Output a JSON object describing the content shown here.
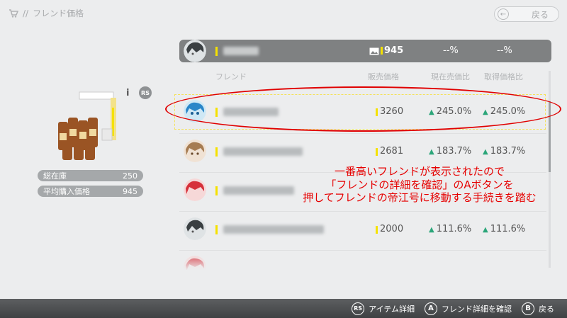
{
  "breadcrumb": {
    "separator": "//",
    "title": "フレンド価格",
    "icon": "cart-icon"
  },
  "back_button": {
    "label": "戻る"
  },
  "item": {
    "info_label": "i",
    "rs_label": "RS",
    "stats": [
      {
        "label": "総在庫",
        "value": "250"
      },
      {
        "label": "平均購入価格",
        "value": "945"
      }
    ]
  },
  "my_row": {
    "price": "945",
    "current_ratio": "--%",
    "acquired_ratio": "--%"
  },
  "columns": {
    "friend": "フレンド",
    "price": "販売価格",
    "current_ratio": "現在売価比",
    "acquired_ratio": "取得価格比"
  },
  "friends": [
    {
      "price": "3260",
      "current_ratio": "245.0%",
      "acquired_ratio": "245.0%"
    },
    {
      "price": "2681",
      "current_ratio": "183.7%",
      "acquired_ratio": "183.7%"
    },
    {
      "price": "",
      "current_ratio": "",
      "acquired_ratio": ""
    },
    {
      "price": "2000",
      "current_ratio": "111.6%",
      "acquired_ratio": "111.6%"
    },
    {
      "price": "",
      "current_ratio": "",
      "acquired_ratio": ""
    }
  ],
  "annotation": {
    "line1": "一番高いフレンドが表示されたので",
    "line2": "「フレンドの詳細を確認」のAボタンを",
    "line3": "押してフレンドの帝江号に移動する手続きを踏む"
  },
  "footer": {
    "hints": [
      {
        "button": "RS",
        "label": "アイテム詳細"
      },
      {
        "button": "A",
        "label": "フレンド詳細を確認"
      },
      {
        "button": "B",
        "label": "戻る"
      }
    ]
  },
  "colors": {
    "accent_yellow": "#f5e100",
    "up_green": "#2ca67a",
    "annotation_red": "#e00000"
  }
}
